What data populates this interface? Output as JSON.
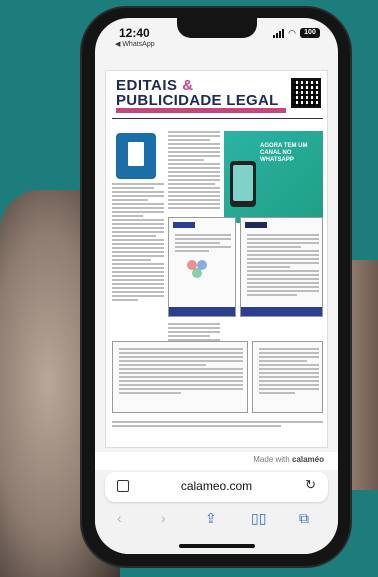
{
  "status": {
    "time": "12:40",
    "back_app": "◀ WhatsApp",
    "battery": "100"
  },
  "document": {
    "title_line1": "EDITAIS",
    "title_amp": "&",
    "title_line2": "PUBLICIDADE LEGAL",
    "promo_text": "AGORA TEM UM CANAL NO WHATSAPP"
  },
  "footer": {
    "made_with_prefix": "Made with",
    "made_with_brand": "calaméo"
  },
  "browser": {
    "url": "calameo.com"
  },
  "icons": {
    "tabs": "tab-icon",
    "reload": "reload-icon",
    "back": "back-icon",
    "forward": "forward-icon",
    "share": "share-icon",
    "bookmarks": "book-icon",
    "tabs_overview": "tabs-icon"
  },
  "colors": {
    "background": "#1d7d7c",
    "title": "#1f2a5a",
    "accent": "#c8467f",
    "promo": "#2bb3a3",
    "link": "#2b6fd6"
  }
}
